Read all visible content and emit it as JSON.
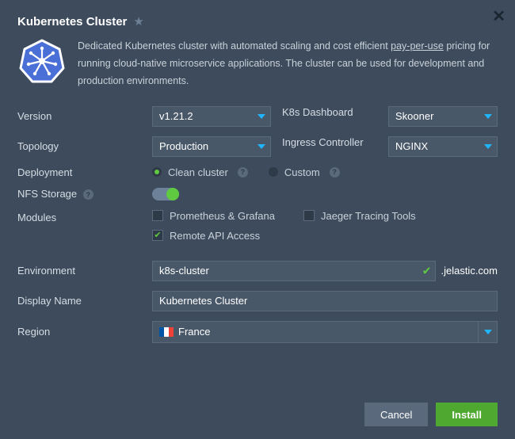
{
  "title": "Kubernetes Cluster",
  "description": {
    "part1": "Dedicated Kubernetes cluster with automated scaling and cost efficient ",
    "underlined": "pay-per-use",
    "part2": " pricing for running cloud-native microservice applications. The cluster can be used for development and production environments."
  },
  "labels": {
    "version": "Version",
    "k8s_dashboard": "K8s Dashboard",
    "topology": "Topology",
    "ingress_controller": "Ingress Controller",
    "deployment": "Deployment",
    "nfs_storage": "NFS Storage",
    "modules": "Modules",
    "environment": "Environment",
    "display_name": "Display Name",
    "region": "Region"
  },
  "values": {
    "version": "v1.21.2",
    "k8s_dashboard": "Skooner",
    "topology": "Production",
    "ingress_controller": "NGINX",
    "environment": "k8s-cluster",
    "domain": ".jelastic.com",
    "display_name": "Kubernetes Cluster",
    "region": "France"
  },
  "deployment": {
    "clean": "Clean cluster",
    "custom": "Custom"
  },
  "modules": {
    "prometheus": "Prometheus & Grafana",
    "jaeger": "Jaeger Tracing Tools",
    "remote_api": "Remote API Access"
  },
  "buttons": {
    "cancel": "Cancel",
    "install": "Install"
  },
  "colors": {
    "accent_blue": "#1fb6ff",
    "accent_green": "#5fc940"
  }
}
